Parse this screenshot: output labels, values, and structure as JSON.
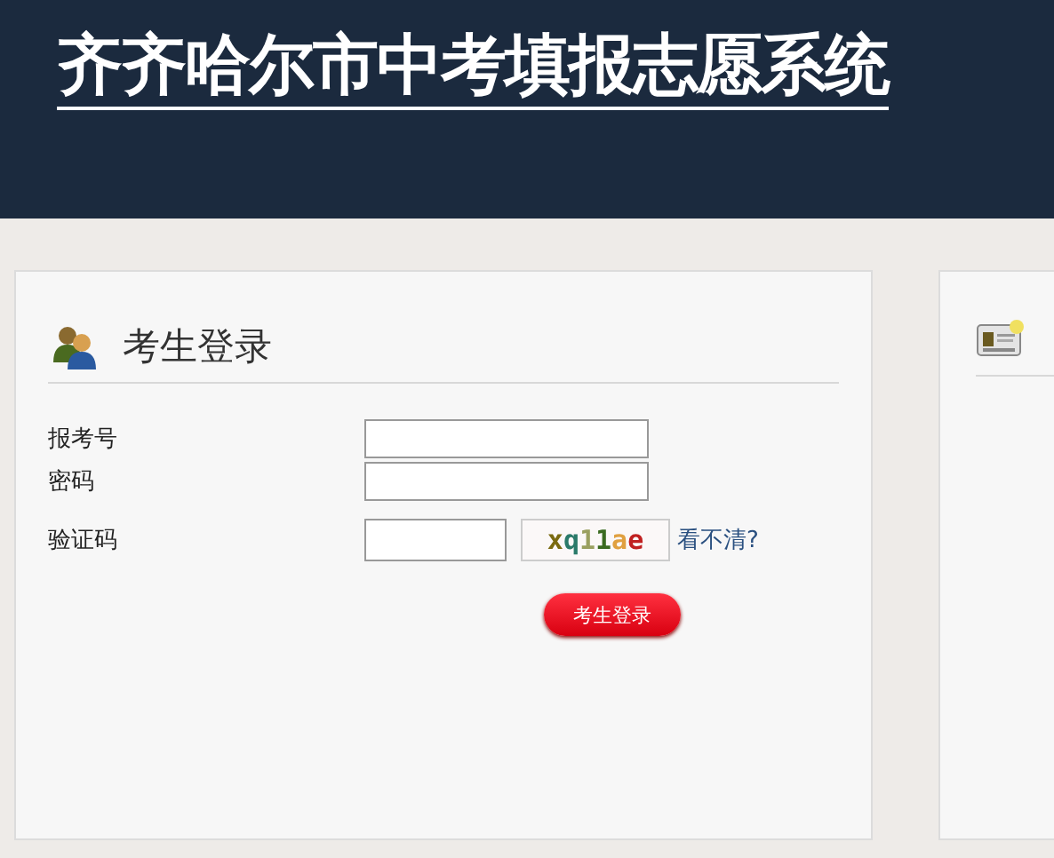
{
  "header": {
    "title": "齐齐哈尔市中考填报志愿系统"
  },
  "login_panel": {
    "title": "考生登录",
    "fields": [
      {
        "label": "报考号",
        "kind": "text"
      },
      {
        "label": "密码",
        "kind": "password"
      },
      {
        "label": "验证码",
        "kind": "captcha"
      }
    ],
    "captcha": "xq11ae",
    "refresh_link": "看不清?",
    "submit_button": "考生登录"
  },
  "side_panel": {
    "kind": "card"
  }
}
